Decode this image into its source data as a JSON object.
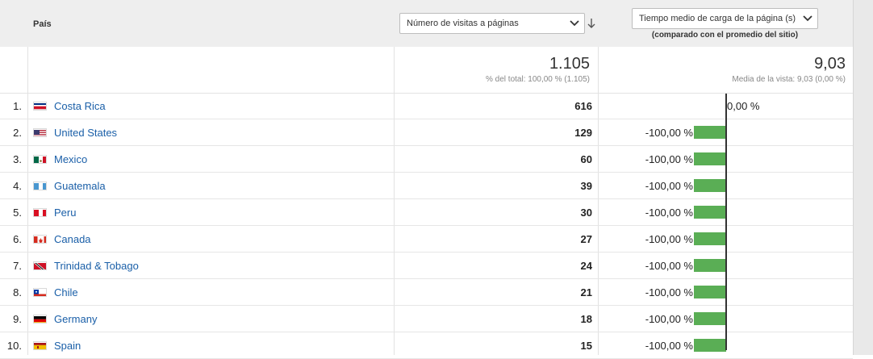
{
  "header": {
    "country_label": "País",
    "primary_metric": "Número de visitas a páginas",
    "secondary_metric": "Tiempo medio de carga de la página (s)",
    "compare_note": "(comparado con el promedio del sitio)"
  },
  "totals": {
    "visits_total": "1.105",
    "visits_sub": "% del total: 100,00 % (1.105)",
    "load_total": "9,03",
    "load_sub": "Media de la vista: 9,03 (0,00 %)"
  },
  "rows": [
    {
      "idx": "1.",
      "country": "Costa Rica",
      "visits": "616",
      "pct": "0,00 %",
      "flag": "costa-rica-flag"
    },
    {
      "idx": "2.",
      "country": "United States",
      "visits": "129",
      "pct": "-100,00 %",
      "flag": "united-states-flag"
    },
    {
      "idx": "3.",
      "country": "Mexico",
      "visits": "60",
      "pct": "-100,00 %",
      "flag": "mexico-flag"
    },
    {
      "idx": "4.",
      "country": "Guatemala",
      "visits": "39",
      "pct": "-100,00 %",
      "flag": "guatemala-flag"
    },
    {
      "idx": "5.",
      "country": "Peru",
      "visits": "30",
      "pct": "-100,00 %",
      "flag": "peru-flag"
    },
    {
      "idx": "6.",
      "country": "Canada",
      "visits": "27",
      "pct": "-100,00 %",
      "flag": "canada-flag"
    },
    {
      "idx": "7.",
      "country": "Trinidad & Tobago",
      "visits": "24",
      "pct": "-100,00 %",
      "flag": "trinidad-tobago-flag"
    },
    {
      "idx": "8.",
      "country": "Chile",
      "visits": "21",
      "pct": "-100,00 %",
      "flag": "chile-flag"
    },
    {
      "idx": "9.",
      "country": "Germany",
      "visits": "18",
      "pct": "-100,00 %",
      "flag": "germany-flag"
    },
    {
      "idx": "10.",
      "country": "Spain",
      "visits": "15",
      "pct": "-100,00 %",
      "flag": "spain-flag"
    }
  ],
  "colors": {
    "bar": "#5aae55",
    "link": "#1a5fa8"
  }
}
